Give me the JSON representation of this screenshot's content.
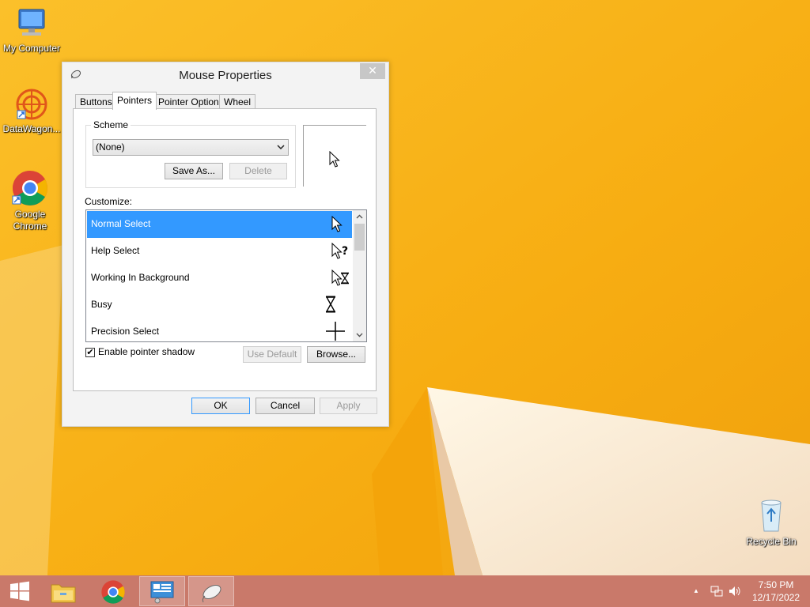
{
  "desktop": {
    "icons": [
      {
        "label": "My Computer"
      },
      {
        "label": "DataWagon..."
      },
      {
        "label": "Google Chrome"
      },
      {
        "label": "Recycle Bin"
      }
    ]
  },
  "window": {
    "title": "Mouse Properties",
    "close_symbol": "✕",
    "tabs": [
      {
        "label": "Buttons"
      },
      {
        "label": "Pointers"
      },
      {
        "label": "Pointer Options"
      },
      {
        "label": "Wheel"
      }
    ],
    "active_tab": "Pointers",
    "scheme": {
      "legend": "Scheme",
      "selected": "(None)",
      "save_as_label": "Save As...",
      "delete_label": "Delete"
    },
    "customize_label": "Customize:",
    "pointers": [
      {
        "label": "Normal Select",
        "icon": "arrow-cursor-icon"
      },
      {
        "label": "Help Select",
        "icon": "help-cursor-icon"
      },
      {
        "label": "Working In Background",
        "icon": "working-cursor-icon"
      },
      {
        "label": "Busy",
        "icon": "hourglass-cursor-icon"
      },
      {
        "label": "Precision Select",
        "icon": "crosshair-cursor-icon"
      }
    ],
    "selected_pointer": "Normal Select",
    "enable_shadow_label": "Enable pointer shadow",
    "enable_shadow_checked": true,
    "check_mark": "✔",
    "use_default_label": "Use Default",
    "browse_label": "Browse...",
    "ok_label": "OK",
    "cancel_label": "Cancel",
    "apply_label": "Apply"
  },
  "taskbar": {
    "time": "7:50 PM",
    "date": "12/17/2022",
    "tray_arrow": "▲"
  },
  "colors": {
    "wallpaper": "#f7b418",
    "taskbar": "#c9796a",
    "selection": "#3399ff"
  }
}
